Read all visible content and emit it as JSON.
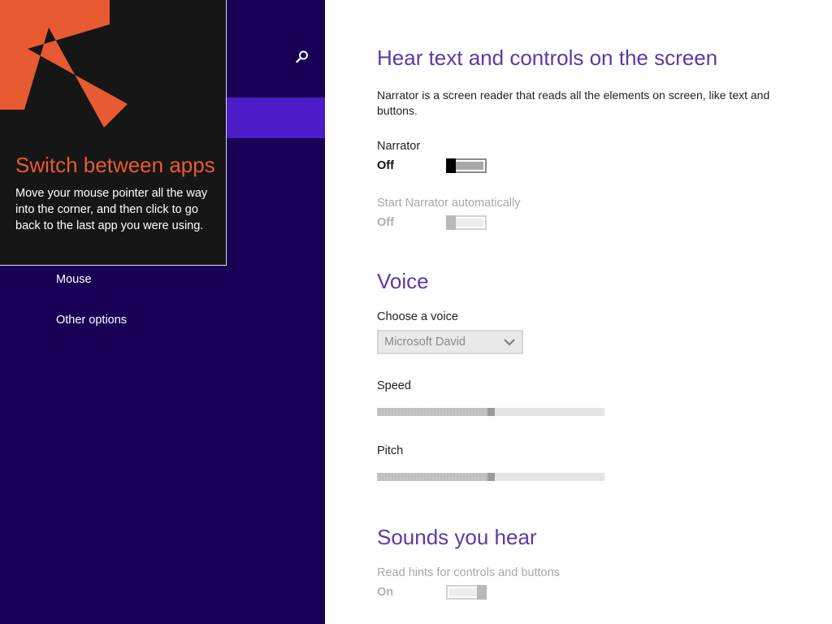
{
  "nav": {
    "items": [
      {
        "label": "Mouse"
      },
      {
        "label": "Other options"
      }
    ]
  },
  "tooltip": {
    "title": "Switch between apps",
    "body": "Move your mouse pointer all the way into the corner, and then click to go back to the last app you were using."
  },
  "content": {
    "hear": {
      "title": "Hear text and controls on the screen",
      "description": "Narrator is a screen reader that reads all the elements on screen, like text and buttons.",
      "narrator": {
        "label": "Narrator",
        "state": "Off"
      },
      "auto_start": {
        "label": "Start Narrator automatically",
        "state": "Off"
      }
    },
    "voice": {
      "title": "Voice",
      "choose_label": "Choose a voice",
      "selected_voice": "Microsoft David",
      "speed": {
        "label": "Speed",
        "value_fraction": 0.5
      },
      "pitch": {
        "label": "Pitch",
        "value_fraction": 0.5
      }
    },
    "sounds": {
      "title": "Sounds you hear",
      "hints": {
        "label": "Read hints for controls and buttons",
        "state": "On"
      }
    }
  },
  "colors": {
    "nav_bg": "#180054",
    "nav_selected": "#4b1cc8",
    "heading": "#5b3aa5",
    "tooltip_accent": "#e85a32"
  }
}
